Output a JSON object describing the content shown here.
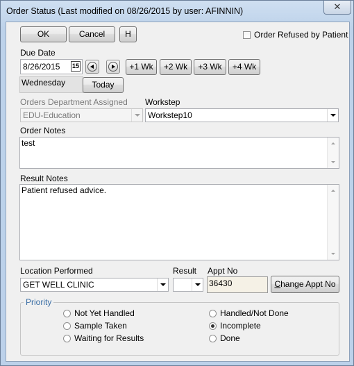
{
  "window": {
    "title": "Order Status (Last modified on 08/26/2015 by user: AFINNIN)",
    "close_glyph": "✕"
  },
  "toolbar": {
    "ok_label": "OK",
    "cancel_label": "Cancel",
    "h_label": "H"
  },
  "refused": {
    "label": "Order Refused by Patient",
    "checked": false
  },
  "due_date": {
    "label": "Due Date",
    "value": "8/26/2015",
    "calendar_glyph": "15",
    "day_of_week": "Wednesday",
    "today_label": "Today",
    "week_buttons": [
      "+1 Wk",
      "+2 Wk",
      "+3 Wk",
      "+4 Wk"
    ]
  },
  "department": {
    "label": "Orders Department Assigned",
    "value": "EDU-Education"
  },
  "workstep": {
    "label": "Workstep",
    "value": "Workstep10"
  },
  "order_notes": {
    "label": "Order Notes",
    "value": "test"
  },
  "result_notes": {
    "label": "Result Notes",
    "value": "Patient refused advice."
  },
  "location": {
    "label": "Location Performed",
    "value": "GET WELL CLINIC"
  },
  "result": {
    "label": "Result",
    "value": ""
  },
  "appt": {
    "label": "Appt No",
    "value": "36430",
    "change_label_prefix": "C",
    "change_label_rest": "hange Appt No"
  },
  "priority": {
    "title": "Priority",
    "options": [
      {
        "label": "Not Yet Handled",
        "selected": false
      },
      {
        "label": "Sample Taken",
        "selected": false
      },
      {
        "label": "Waiting for Results",
        "selected": false
      },
      {
        "label": "Handled/Not Done",
        "selected": false
      },
      {
        "label": "Incomplete",
        "selected": true
      },
      {
        "label": "Done",
        "selected": false
      }
    ]
  }
}
